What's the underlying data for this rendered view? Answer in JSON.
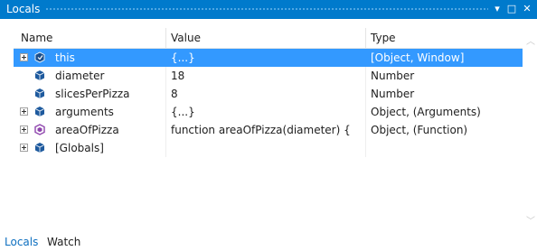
{
  "window": {
    "title": "Locals",
    "buttons": {
      "dropdown": "▾",
      "maximize": "□",
      "close": "✕"
    }
  },
  "columns": {
    "name": "Name",
    "value": "Value",
    "type": "Type"
  },
  "rows": [
    {
      "name": "this",
      "value": "{...}",
      "type": "[Object, Window]",
      "expandable": true,
      "icon": "object-icon",
      "selected": true
    },
    {
      "name": "diameter",
      "value": "18",
      "type": "Number",
      "expandable": false,
      "icon": "variable-icon",
      "selected": false
    },
    {
      "name": "slicesPerPizza",
      "value": "8",
      "type": "Number",
      "expandable": false,
      "icon": "variable-icon",
      "selected": false
    },
    {
      "name": "arguments",
      "value": "{...}",
      "type": "Object, (Arguments)",
      "expandable": true,
      "icon": "variable-icon",
      "selected": false
    },
    {
      "name": "areaOfPizza",
      "value": "function areaOfPizza(diameter) {",
      "type": "Object, (Function)",
      "expandable": true,
      "icon": "function-icon",
      "selected": false
    },
    {
      "name": "[Globals]",
      "value": "",
      "type": "",
      "expandable": true,
      "icon": "variable-icon",
      "selected": false
    }
  ],
  "tabs": {
    "locals": "Locals",
    "watch": "Watch"
  },
  "colors": {
    "titlebar": "#007acc",
    "selection": "#3399ff",
    "active_tab": "#0e70c0",
    "function_icon": "#8e44ad",
    "variable_icon": "#1e5a9e"
  }
}
